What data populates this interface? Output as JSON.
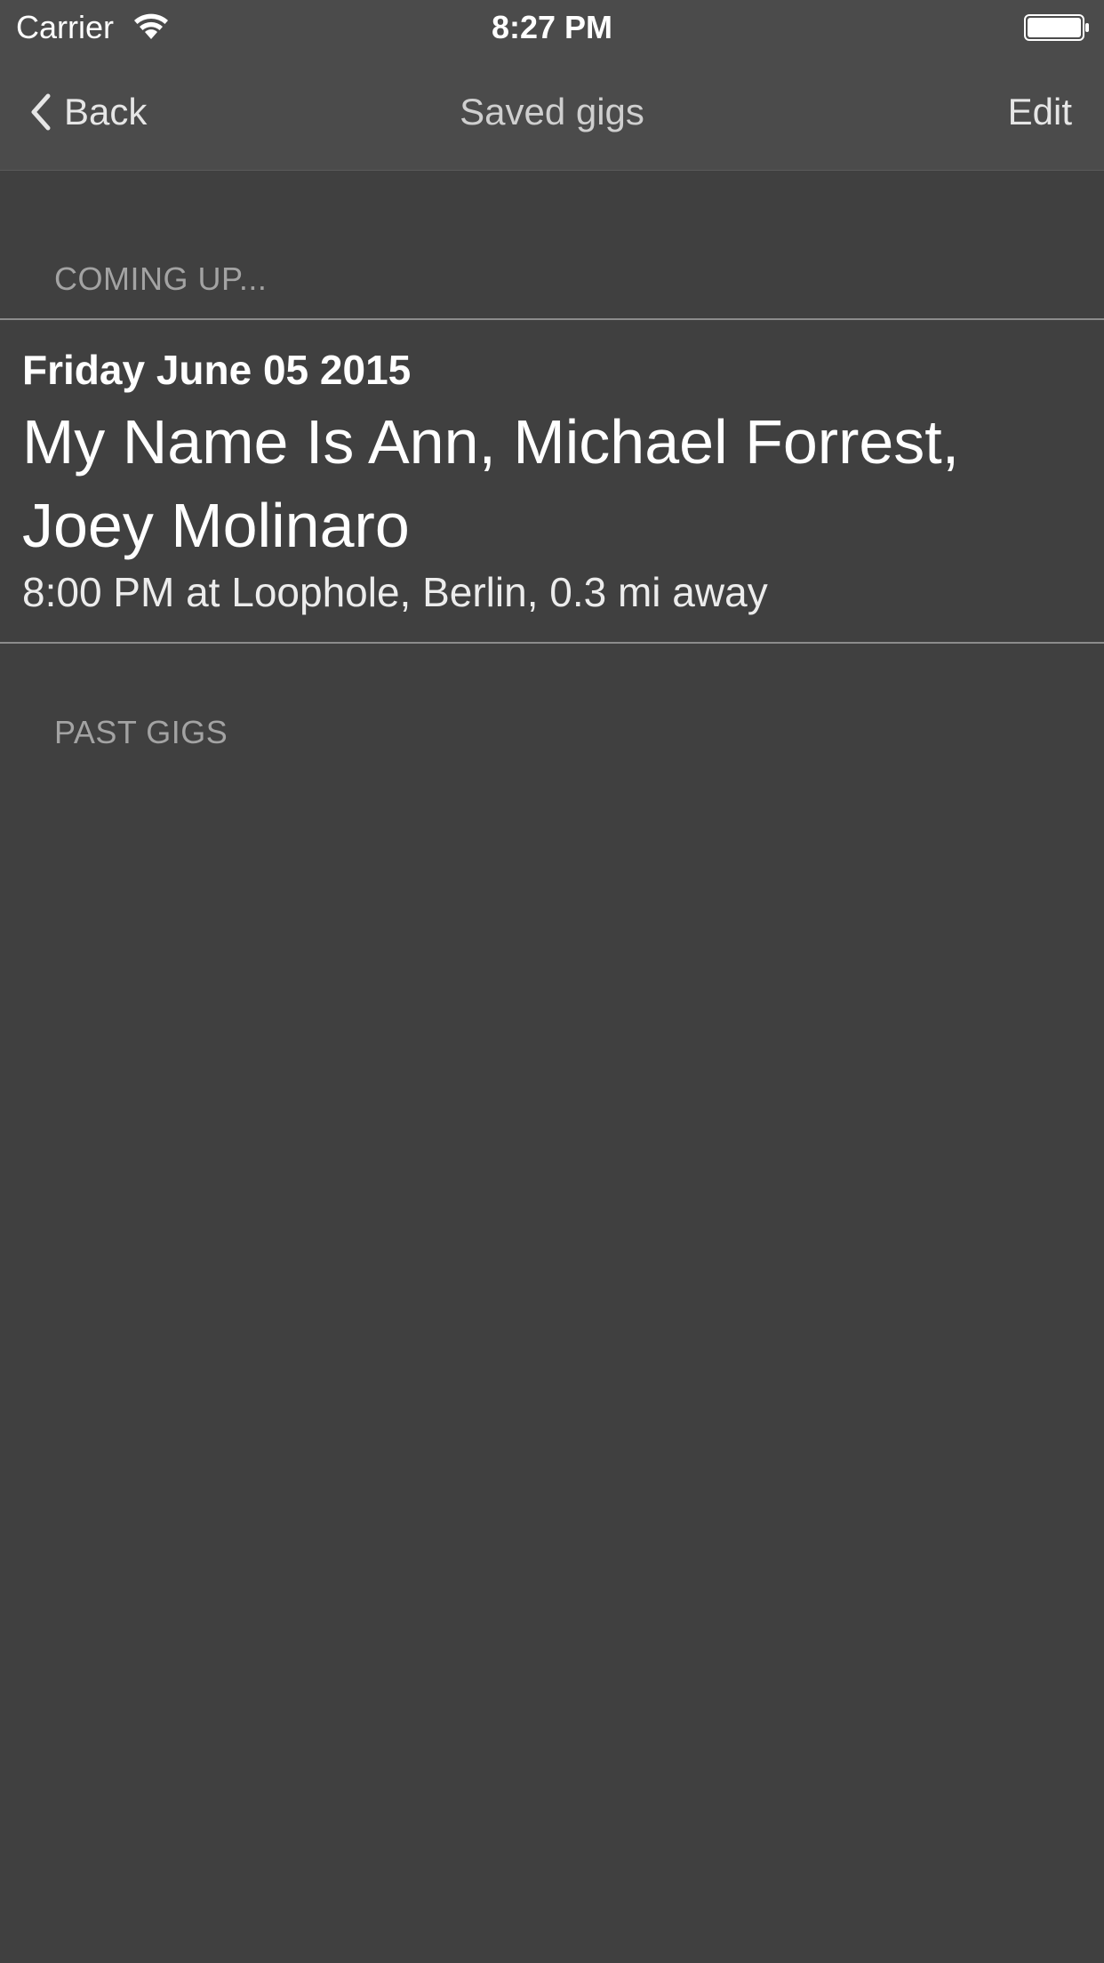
{
  "status_bar": {
    "carrier": "Carrier",
    "time": "8:27 PM",
    "icons": [
      "wifi-icon",
      "battery-icon"
    ]
  },
  "nav_bar": {
    "back_label": "Back",
    "title": "Saved gigs",
    "edit_label": "Edit",
    "icons": [
      "chevron-left-icon"
    ]
  },
  "sections": {
    "coming_up": {
      "header": "COMING UP...",
      "gigs": [
        {
          "date": "Friday June 05 2015",
          "artists": "My Name Is Ann, Michael Forrest, Joey Molinaro",
          "details": "8:00 PM at Loophole, Berlin, 0.3 mi away"
        }
      ]
    },
    "past": {
      "header": "PAST GIGS"
    }
  },
  "colors": {
    "background": "#404040",
    "bar_background": "#4b4b4b",
    "section_header_text": "#a3a3a3",
    "divider": "#8c8c8c",
    "primary_text": "#ffffff"
  }
}
